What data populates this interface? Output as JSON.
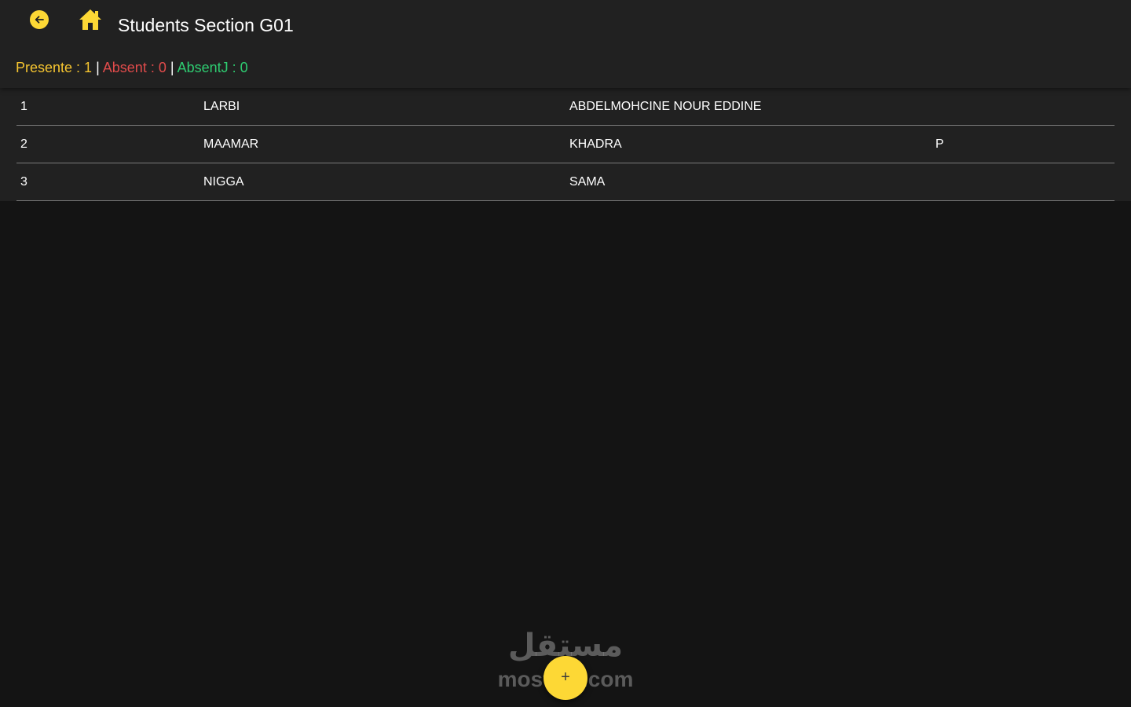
{
  "header": {
    "title": "Students Section G01",
    "back_icon": "arrow-left-circle-icon",
    "home_icon": "home-icon",
    "accent_color": "#fdd835"
  },
  "summary": {
    "present_label": "Presente : 1",
    "absent_label": "Absent : 0",
    "absentj_label": "AbsentJ : 0",
    "separator": "|",
    "present_color": "#f6c530",
    "absent_color": "#e04b4b",
    "absentj_color": "#2ecc71"
  },
  "students": [
    {
      "number": "1",
      "last_name": "LARBI",
      "first_name": "ABDELMOHCINE NOUR EDDINE",
      "status": ""
    },
    {
      "number": "2",
      "last_name": "MAAMAR",
      "first_name": "KHADRA",
      "status": "P"
    },
    {
      "number": "3",
      "last_name": "NIGGA",
      "first_name": "SAMA",
      "status": ""
    }
  ],
  "fab": {
    "icon": "plus-icon",
    "glyph": "+"
  },
  "watermark": {
    "arabic": "مستقل",
    "latin": "mostaql.com"
  }
}
